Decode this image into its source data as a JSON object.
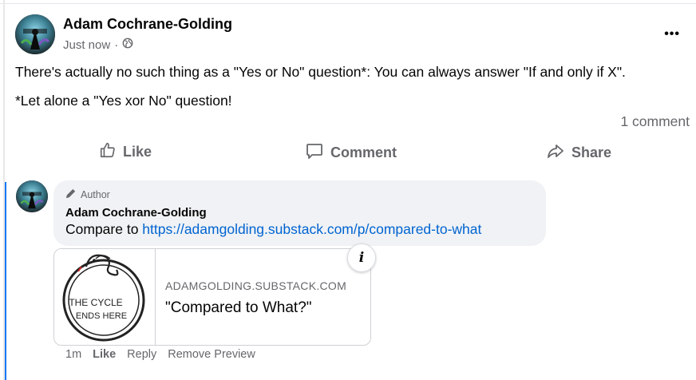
{
  "post": {
    "author": "Adam Cochrane-Golding",
    "timestamp": "Just now",
    "privacy_icon": "globe-icon",
    "text_line1": "There's actually no such thing as a \"Yes or No\" question*:  You can always answer  \"If and only if X\".",
    "text_line2": "*Let alone a \"Yes xor No\" question!",
    "comment_count": "1 comment",
    "more_label": "•••"
  },
  "actions": {
    "like": "Like",
    "comment": "Comment",
    "share": "Share"
  },
  "comment": {
    "badge": "Author",
    "author": "Adam Cochrane-Golding",
    "text_prefix": "Compare to ",
    "link": "https://adamgolding.substack.com/p/compared-to-what",
    "preview": {
      "domain": "ADAMGOLDING.SUBSTACK.COM",
      "title": "\"Compared to What?\"",
      "image_text_line1": "THE CYCLE",
      "image_text_line2": "ENDS HERE",
      "info_label": "i"
    },
    "time": "1m",
    "like": "Like",
    "reply": "Reply",
    "remove_preview": "Remove Preview"
  },
  "colors": {
    "link": "#0064d1",
    "thread_line": "#1877f2",
    "secondary_text": "#65676b",
    "bubble_bg": "#f0f2f5"
  }
}
